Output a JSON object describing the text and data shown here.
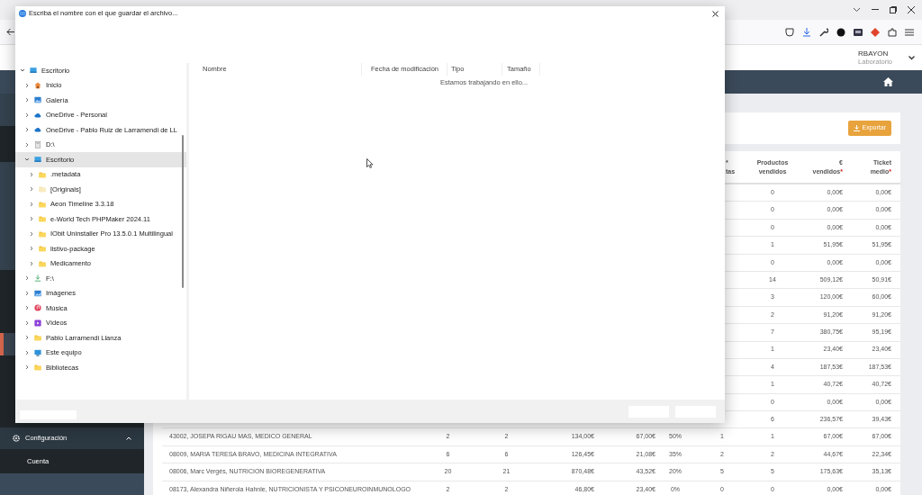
{
  "browser": {
    "user": "RBAYON",
    "role": "Laboratorio"
  },
  "sidebar": {
    "items": [
      {
        "label": "Configuración",
        "kind": "section",
        "expanded": true
      },
      {
        "label": "Cuenta",
        "kind": "link"
      }
    ]
  },
  "toolbar": {
    "export_button": "Exportar"
  },
  "table": {
    "columns": [
      null,
      null,
      null,
      null,
      null,
      null,
      {
        "lines": [
          "*",
          "tas"
        ]
      },
      {
        "lines": [
          "Productos",
          "vendidos"
        ]
      },
      {
        "lines": [
          "€",
          "vendidos"
        ],
        "required": true
      },
      {
        "lines": [
          "Ticket",
          "medio"
        ],
        "required": true
      }
    ],
    "rows": [
      {
        "cells": [
          "",
          "",
          "",
          "",
          "",
          "",
          "",
          "0",
          "0,00€",
          "0,00€"
        ]
      },
      {
        "cells": [
          "",
          "",
          "",
          "",
          "",
          "",
          "",
          "0",
          "0,00€",
          "0,00€"
        ]
      },
      {
        "cells": [
          "",
          "",
          "",
          "",
          "",
          "",
          "",
          "0",
          "0,00€",
          "0,00€"
        ]
      },
      {
        "cells": [
          "",
          "",
          "",
          "",
          "",
          "",
          "",
          "1",
          "51,95€",
          "51,95€"
        ]
      },
      {
        "cells": [
          "",
          "",
          "",
          "",
          "",
          "",
          "",
          "0",
          "0,00€",
          "0,00€"
        ]
      },
      {
        "cells": [
          "",
          "",
          "",
          "",
          "",
          "",
          "",
          "14",
          "509,12€",
          "50,91€"
        ]
      },
      {
        "cells": [
          "",
          "",
          "",
          "",
          "",
          "",
          "",
          "3",
          "120,00€",
          "60,00€"
        ]
      },
      {
        "cells": [
          "",
          "",
          "",
          "",
          "",
          "",
          "",
          "2",
          "91,20€",
          "91,20€"
        ]
      },
      {
        "cells": [
          "",
          "",
          "",
          "",
          "",
          "",
          "",
          "7",
          "380,75€",
          "95,19€"
        ]
      },
      {
        "cells": [
          "",
          "",
          "",
          "",
          "",
          "",
          "",
          "1",
          "23,40€",
          "23,40€"
        ]
      },
      {
        "cells": [
          "",
          "",
          "",
          "",
          "",
          "",
          "",
          "4",
          "187,53€",
          "187,53€"
        ]
      },
      {
        "cells": [
          "",
          "",
          "",
          "",
          "",
          "",
          "",
          "1",
          "40,72€",
          "40,72€"
        ]
      },
      {
        "cells": [
          "",
          "",
          "",
          "",
          "",
          "",
          "",
          "0",
          "0,00€",
          "0,00€"
        ]
      },
      {
        "cells": [
          "",
          "",
          "",
          "",
          "",
          "",
          "",
          "6",
          "236,57€",
          "39,43€"
        ]
      },
      {
        "cells": [
          "43002, JOSEPA RIGAU MAS, MEDICO GENERAL",
          "2",
          "2",
          "134,00€",
          "67,00€",
          "50%",
          "1",
          "1",
          "67,00€",
          "67,00€"
        ]
      },
      {
        "cells": [
          "08009, MARIA TERESA BRAVO, MEDICINA INTEGRATIVA",
          "6",
          "6",
          "126,45€",
          "21,08€",
          "35%",
          "2",
          "2",
          "44,67€",
          "22,34€"
        ]
      },
      {
        "cells": [
          "08006, Marc Vergés, NUTRICION BIOREGENERATIVA",
          "20",
          "21",
          "870,48€",
          "43,52€",
          "20%",
          "5",
          "5",
          "175,63€",
          "35,13€"
        ]
      },
      {
        "cells": [
          "08173, Alexandra Niñerola Hahnle, NUTRICIONISTA Y PSICONEUROINMUNOLOGO",
          "2",
          "2",
          "46,80€",
          "23,40€",
          "0%",
          "0",
          "0",
          "0,00€",
          "0,00€"
        ]
      }
    ]
  },
  "dialog": {
    "title": "Escriba el nombre con el que guardar el archivo...",
    "tree": [
      {
        "label": "Escritorio",
        "kind": "desktop",
        "expanded": true,
        "selected": false,
        "children": [
          {
            "label": "Inicio",
            "kind": "home",
            "expanded": false,
            "selected": false
          },
          {
            "label": "Galería",
            "kind": "gallery",
            "expanded": false,
            "selected": false
          },
          {
            "label": "OneDrive - Personal",
            "kind": "cloud",
            "expanded": false,
            "selected": false
          },
          {
            "label": "OneDrive - Pablo Ruiz de Larramendi de LL",
            "kind": "cloud",
            "expanded": false,
            "selected": false
          },
          {
            "label": "D:\\",
            "kind": "drive",
            "expanded": false,
            "selected": false
          },
          {
            "label": "Escritorio",
            "kind": "desktop",
            "expanded": true,
            "selected": true,
            "children": [
              {
                "label": ".metadata",
                "kind": "folder",
                "expanded": false,
                "selected": false
              },
              {
                "label": "[Originals]",
                "kind": "folder-light",
                "expanded": false,
                "selected": false
              },
              {
                "label": "Aeon Timeline 3.3.18",
                "kind": "folder",
                "expanded": false,
                "selected": false
              },
              {
                "label": "e-World Tech PHPMaker 2024.11",
                "kind": "folder",
                "expanded": false,
                "selected": false
              },
              {
                "label": "IObit Uninstaller Pro 13.5.0.1 Multilingual",
                "kind": "folder",
                "expanded": false,
                "selected": false
              },
              {
                "label": "listivo-package",
                "kind": "folder",
                "expanded": false,
                "selected": false
              },
              {
                "label": "Medicamento",
                "kind": "folder",
                "expanded": false,
                "selected": false
              }
            ]
          },
          {
            "label": "F:\\",
            "kind": "download",
            "expanded": false,
            "selected": false
          },
          {
            "label": "Imágenes",
            "kind": "images",
            "expanded": false,
            "selected": false
          },
          {
            "label": "Música",
            "kind": "music",
            "expanded": false,
            "selected": false
          },
          {
            "label": "Vídeos",
            "kind": "video",
            "expanded": false,
            "selected": false
          },
          {
            "label": "Pablo Larramendi Llanza",
            "kind": "folder",
            "expanded": false,
            "selected": false
          },
          {
            "label": "Este equipo",
            "kind": "computer",
            "expanded": false,
            "selected": false
          },
          {
            "label": "Bibliotecas",
            "kind": "folder",
            "expanded": false,
            "selected": false
          }
        ]
      }
    ],
    "columns": [
      "Nombre",
      "Fecha de modificación",
      "Tipo",
      "Tamaño"
    ],
    "status": "Estamos trabajando en ello..."
  }
}
